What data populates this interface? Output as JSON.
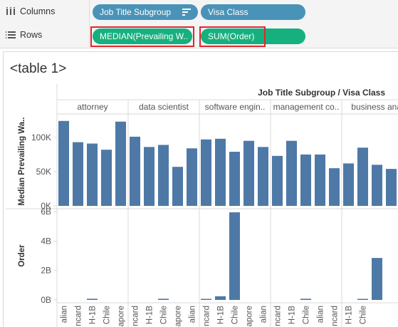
{
  "shelves": {
    "columns_label": "Columns",
    "rows_label": "Rows",
    "columns_pills": [
      "Job Title Subgroup",
      "Visa Class"
    ],
    "rows_pills": [
      "MEDIAN(Prevailing W..",
      "SUM(Order)"
    ]
  },
  "sheet": {
    "title": "<table 1>"
  },
  "colors": {
    "bar": "#4e79a7",
    "pill_blue": "#4a93b8",
    "pill_green": "#16b07e",
    "highlight": "#e0262d"
  },
  "chart_data": {
    "type": "bar",
    "header_title": "Job Title Subgroup / Visa Class",
    "groups": [
      "attorney",
      "data scientist",
      "software engin..",
      "management co..",
      "business anal"
    ],
    "x_tick_labels": [
      "alian",
      "ncard",
      "H-1B",
      "Chile",
      "apore",
      "ncard",
      "H-1B",
      "Chile",
      "apore",
      "alian",
      "ncard",
      "H-1B",
      "Chile",
      "apore",
      "alian",
      "ncard",
      "H-1B",
      "Chile",
      "alian",
      "ncard",
      "H-1B",
      "Chile"
    ],
    "panels": [
      {
        "ylabel": "Median Prevailing Wa..",
        "ticks": [
          "0K",
          "50K",
          "100K"
        ],
        "ylim": [
          0,
          130000
        ],
        "series": [
          {
            "group": "attorney",
            "values": [
              124000,
              93000,
              91000,
              82000,
              123000
            ]
          },
          {
            "group": "data scientist",
            "values": [
              101000,
              86000,
              89000,
              57000,
              84000
            ]
          },
          {
            "group": "software engin..",
            "values": [
              97000,
              98000,
              79000,
              95000,
              86000
            ]
          },
          {
            "group": "management co..",
            "values": [
              73000,
              95000,
              75000,
              75000,
              55000
            ]
          },
          {
            "group": "business anal",
            "values": [
              62000,
              85000,
              60000,
              54000
            ]
          }
        ]
      },
      {
        "ylabel": "Order",
        "ticks": [
          "0B",
          "2B",
          "4B",
          "6B"
        ],
        "ylim": [
          0,
          6000000000
        ],
        "series": [
          {
            "group": "attorney",
            "values": [
              0,
              0,
              80000000,
              0,
              0
            ]
          },
          {
            "group": "data scientist",
            "values": [
              0,
              0,
              80000000,
              0,
              0
            ]
          },
          {
            "group": "software engin..",
            "values": [
              60000000,
              250000000,
              5950000000,
              0,
              0
            ]
          },
          {
            "group": "management co..",
            "values": [
              0,
              0,
              80000000,
              0,
              0
            ]
          },
          {
            "group": "business anal",
            "values": [
              0,
              60000000,
              2850000000,
              0
            ]
          }
        ]
      }
    ]
  }
}
